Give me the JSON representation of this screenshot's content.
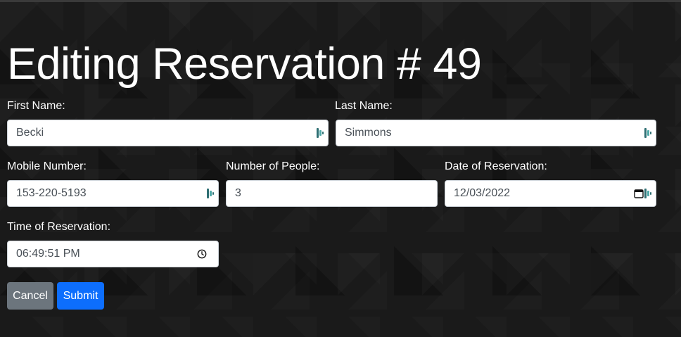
{
  "page": {
    "title": "Editing Reservation # 49"
  },
  "form": {
    "first_name": {
      "label": "First Name:",
      "value": "Becki"
    },
    "last_name": {
      "label": "Last Name:",
      "value": "Simmons"
    },
    "mobile_number": {
      "label": "Mobile Number:",
      "value": "153-220-5193"
    },
    "people": {
      "label": "Number of People:",
      "value": "3"
    },
    "date": {
      "label": "Date of Reservation:",
      "value": "12/03/2022"
    },
    "time": {
      "label": "Time of Reservation:",
      "value": "06:49:51 PM"
    }
  },
  "buttons": {
    "cancel_label": "Cancel",
    "submit_label": "Submit"
  },
  "icons": {
    "password_manager": "password-manager-icon",
    "calendar": "calendar-icon",
    "clock": "clock-icon"
  },
  "colors": {
    "cancel": "#6c757d",
    "submit": "#0d6efd",
    "background": "#1a1a1a"
  }
}
